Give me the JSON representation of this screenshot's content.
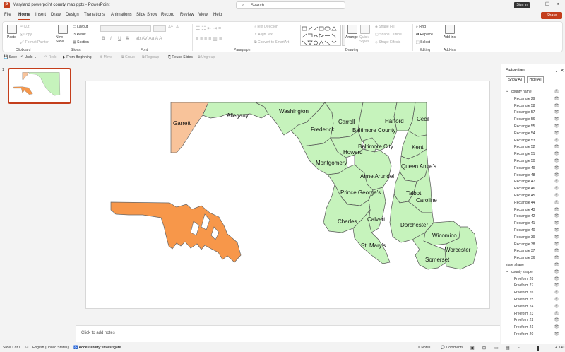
{
  "titlebar": {
    "logo": "P",
    "title": "Maryland powerpoint county map.pptx - PowerPoint",
    "search_placeholder": "Search",
    "search_icon": "search-icon",
    "signin": "Sign in",
    "minimize": "—",
    "maximize": "☐",
    "close": "✕"
  },
  "menu": {
    "tabs": [
      "File",
      "Home",
      "Insert",
      "Draw",
      "Design",
      "Transitions",
      "Animations",
      "Slide Show",
      "Record",
      "Review",
      "View",
      "Help"
    ],
    "share": "Share"
  },
  "ribbon": {
    "clipboard": {
      "paste": "Paste",
      "cut": "Cut",
      "copy": "Copy",
      "format_painter": "Format Painter",
      "label": "Clipboard"
    },
    "slides": {
      "new_slide": "New Slide",
      "layout": "Layout",
      "reset": "Reset",
      "section": "Section",
      "label": "Slides"
    },
    "font": {
      "label": "Font",
      "bold": "B",
      "italic": "I",
      "underline": "U",
      "strike": "S",
      "sizeup": "A^",
      "sizedown": "Aˇ"
    },
    "paragraph": {
      "label": "Paragraph",
      "text_direction": "Text Direction",
      "align_text": "Align Text",
      "smartart": "Convert to SmartArt"
    },
    "drawing": {
      "label": "Drawing",
      "arrange": "Arrange",
      "quick_styles": "Quick Styles",
      "shape_fill": "Shape Fill",
      "shape_outline": "Shape Outline",
      "shape_effects": "Shape Effects"
    },
    "editing": {
      "label": "Editing",
      "find": "Find",
      "replace": "Replace",
      "select": "Select"
    },
    "addins": {
      "label": "Add-ins",
      "addins": "Add-ins"
    }
  },
  "qat": {
    "save": "Save",
    "undo": "Undo",
    "redo": "Redo",
    "from_beginning": "From Beginning",
    "move": "Move",
    "group": "Group",
    "regroup": "Regroup",
    "reuse_slides": "Reuse Slides",
    "ungroup": "Ungroup"
  },
  "slides_pane": {
    "number": "1"
  },
  "map": {
    "labels": [
      "Garrett",
      "Allegany",
      "Washington",
      "Frederick",
      "Carroll",
      "Baltimore County",
      "Harford",
      "Cecil",
      "Baltimore City",
      "Howard",
      "Kent",
      "Montgomery",
      "Anne Arundel",
      "Queen Anne's",
      "Prince George's",
      "Talbot",
      "Caroline",
      "Calvert",
      "Charles",
      "Dorchester",
      "St. Mary's",
      "Wicomico",
      "Worcester",
      "Somerset"
    ],
    "colors": {
      "county": "#c6f3bc",
      "garrett": "#f8c39a",
      "state": "#f7974a"
    }
  },
  "notes": {
    "placeholder": "Click to add notes"
  },
  "selection": {
    "title": "Selection",
    "show_all": "Show All",
    "hide_all": "Hide All",
    "items": [
      {
        "name": "county name",
        "group": true
      },
      {
        "name": "Rectangle 29"
      },
      {
        "name": "Rectangle 58"
      },
      {
        "name": "Rectangle 57"
      },
      {
        "name": "Rectangle 56"
      },
      {
        "name": "Rectangle 55"
      },
      {
        "name": "Rectangle 54"
      },
      {
        "name": "Rectangle 53"
      },
      {
        "name": "Rectangle 52"
      },
      {
        "name": "Rectangle 51"
      },
      {
        "name": "Rectangle 50"
      },
      {
        "name": "Rectangle 49"
      },
      {
        "name": "Rectangle 48"
      },
      {
        "name": "Rectangle 47"
      },
      {
        "name": "Rectangle 46"
      },
      {
        "name": "Rectangle 45"
      },
      {
        "name": "Rectangle 44"
      },
      {
        "name": "Rectangle 43"
      },
      {
        "name": "Rectangle 42"
      },
      {
        "name": "Rectangle 41"
      },
      {
        "name": "Rectangle 40"
      },
      {
        "name": "Rectangle 39"
      },
      {
        "name": "Rectangle 38"
      },
      {
        "name": "Rectangle 37"
      },
      {
        "name": "Rectangle 36"
      },
      {
        "name": "state shape",
        "group": false,
        "top": true
      },
      {
        "name": "county shape",
        "group": true
      },
      {
        "name": "Freeform 28"
      },
      {
        "name": "Freeform 27"
      },
      {
        "name": "Freeform 26"
      },
      {
        "name": "Freeform 25"
      },
      {
        "name": "Freeform 24"
      },
      {
        "name": "Freeform 23"
      },
      {
        "name": "Freeform 22"
      },
      {
        "name": "Freeform 21"
      },
      {
        "name": "Freeform 20"
      }
    ]
  },
  "status": {
    "slide": "Slide 1 of 1",
    "language": "English (United States)",
    "accessibility": "Accessibility: Investigate",
    "notes": "Notes",
    "comments": "Comments",
    "zoom": "140"
  }
}
